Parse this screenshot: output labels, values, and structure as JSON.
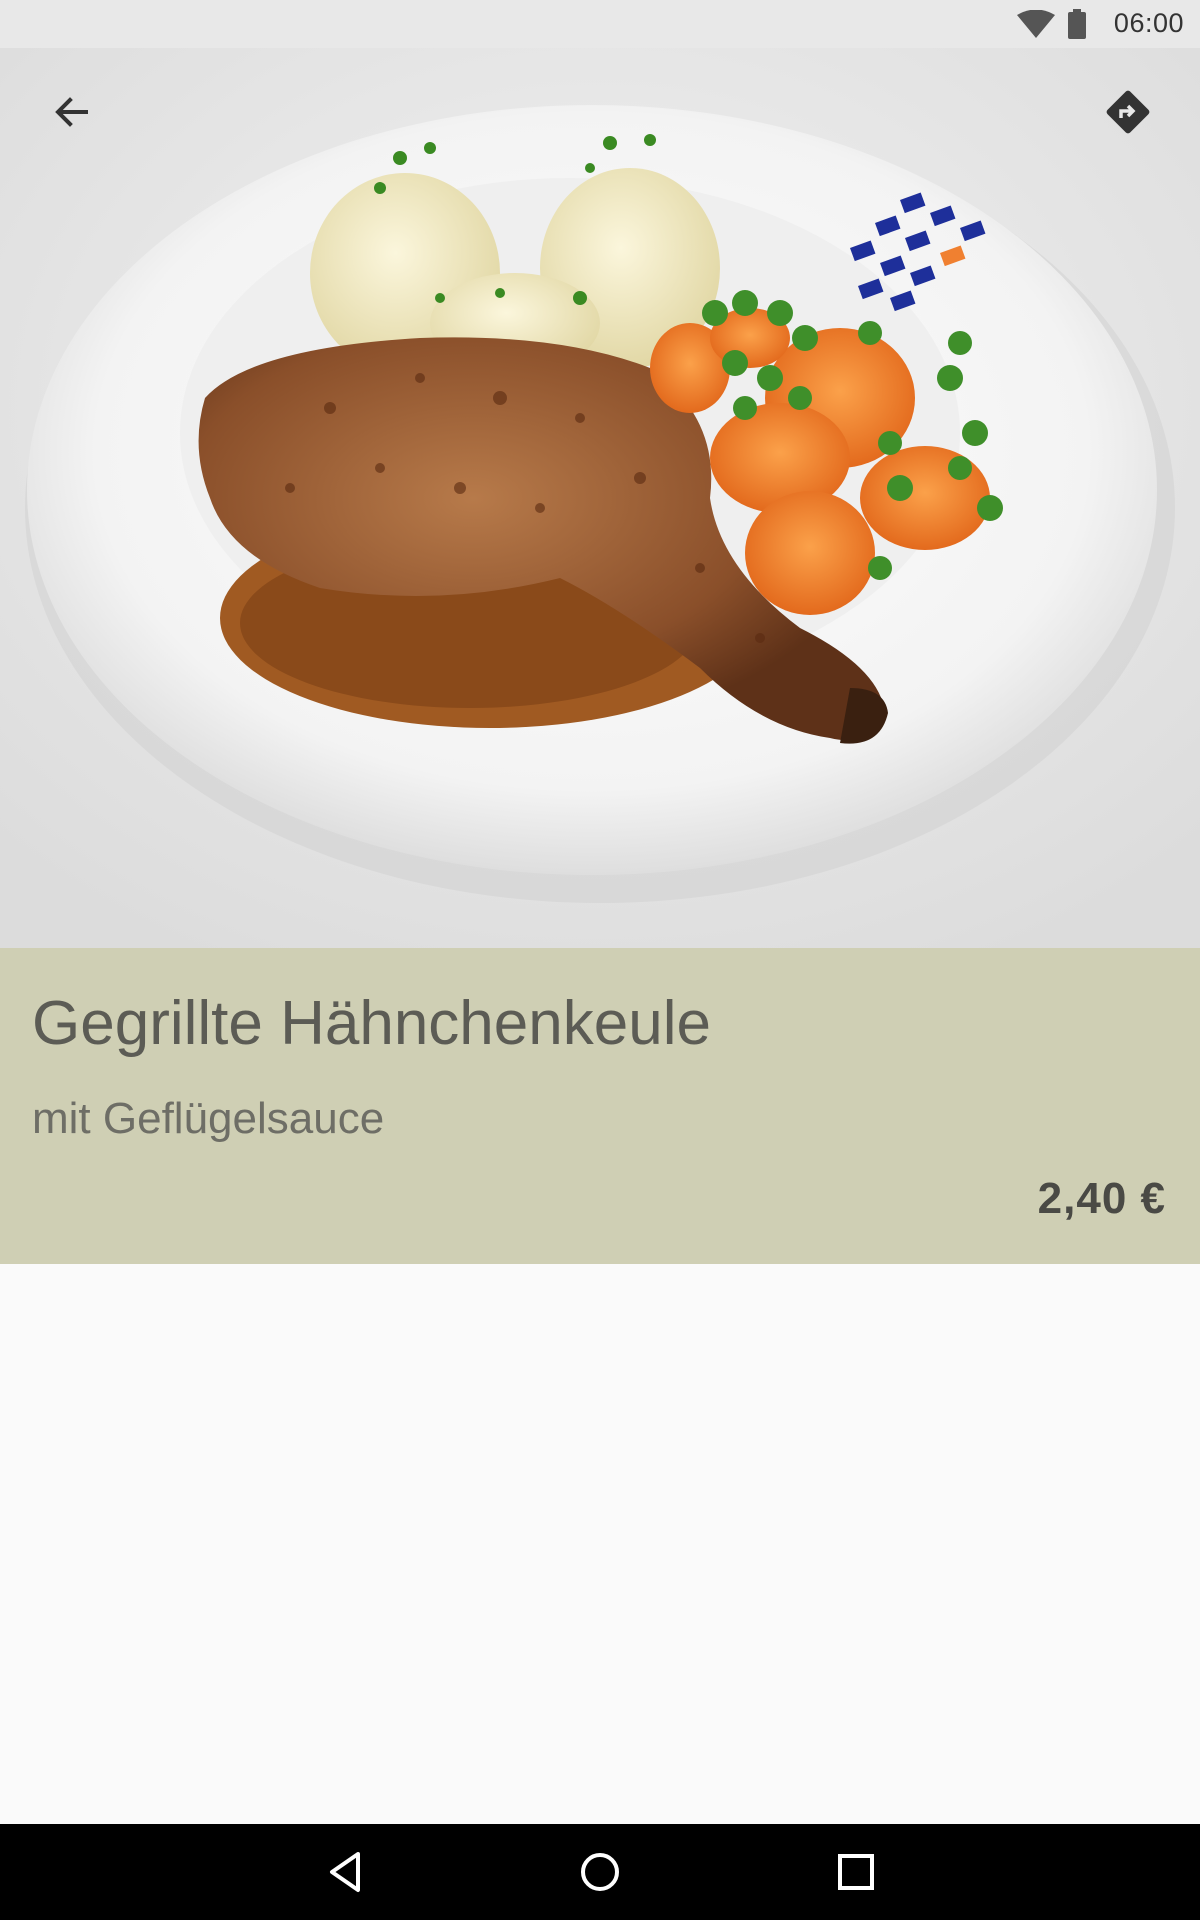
{
  "status_bar": {
    "time": "06:00",
    "icons": [
      "wifi-icon",
      "battery-icon"
    ]
  },
  "appbar": {
    "back_icon": "arrow-back-icon",
    "directions_icon": "directions-icon"
  },
  "dish": {
    "title": "Gegrillte Hähnchenkeule",
    "subtitle": "mit Geflügelsauce",
    "price": "2,40 €"
  },
  "colors": {
    "panel_background": "#cfcfb4",
    "status_bar": "#e8e8e8",
    "nav_bar": "#000000",
    "page_background": "#fafafa"
  },
  "nav_bar": {
    "icons": [
      "nav-back-icon",
      "nav-home-icon",
      "nav-recent-icon"
    ]
  }
}
